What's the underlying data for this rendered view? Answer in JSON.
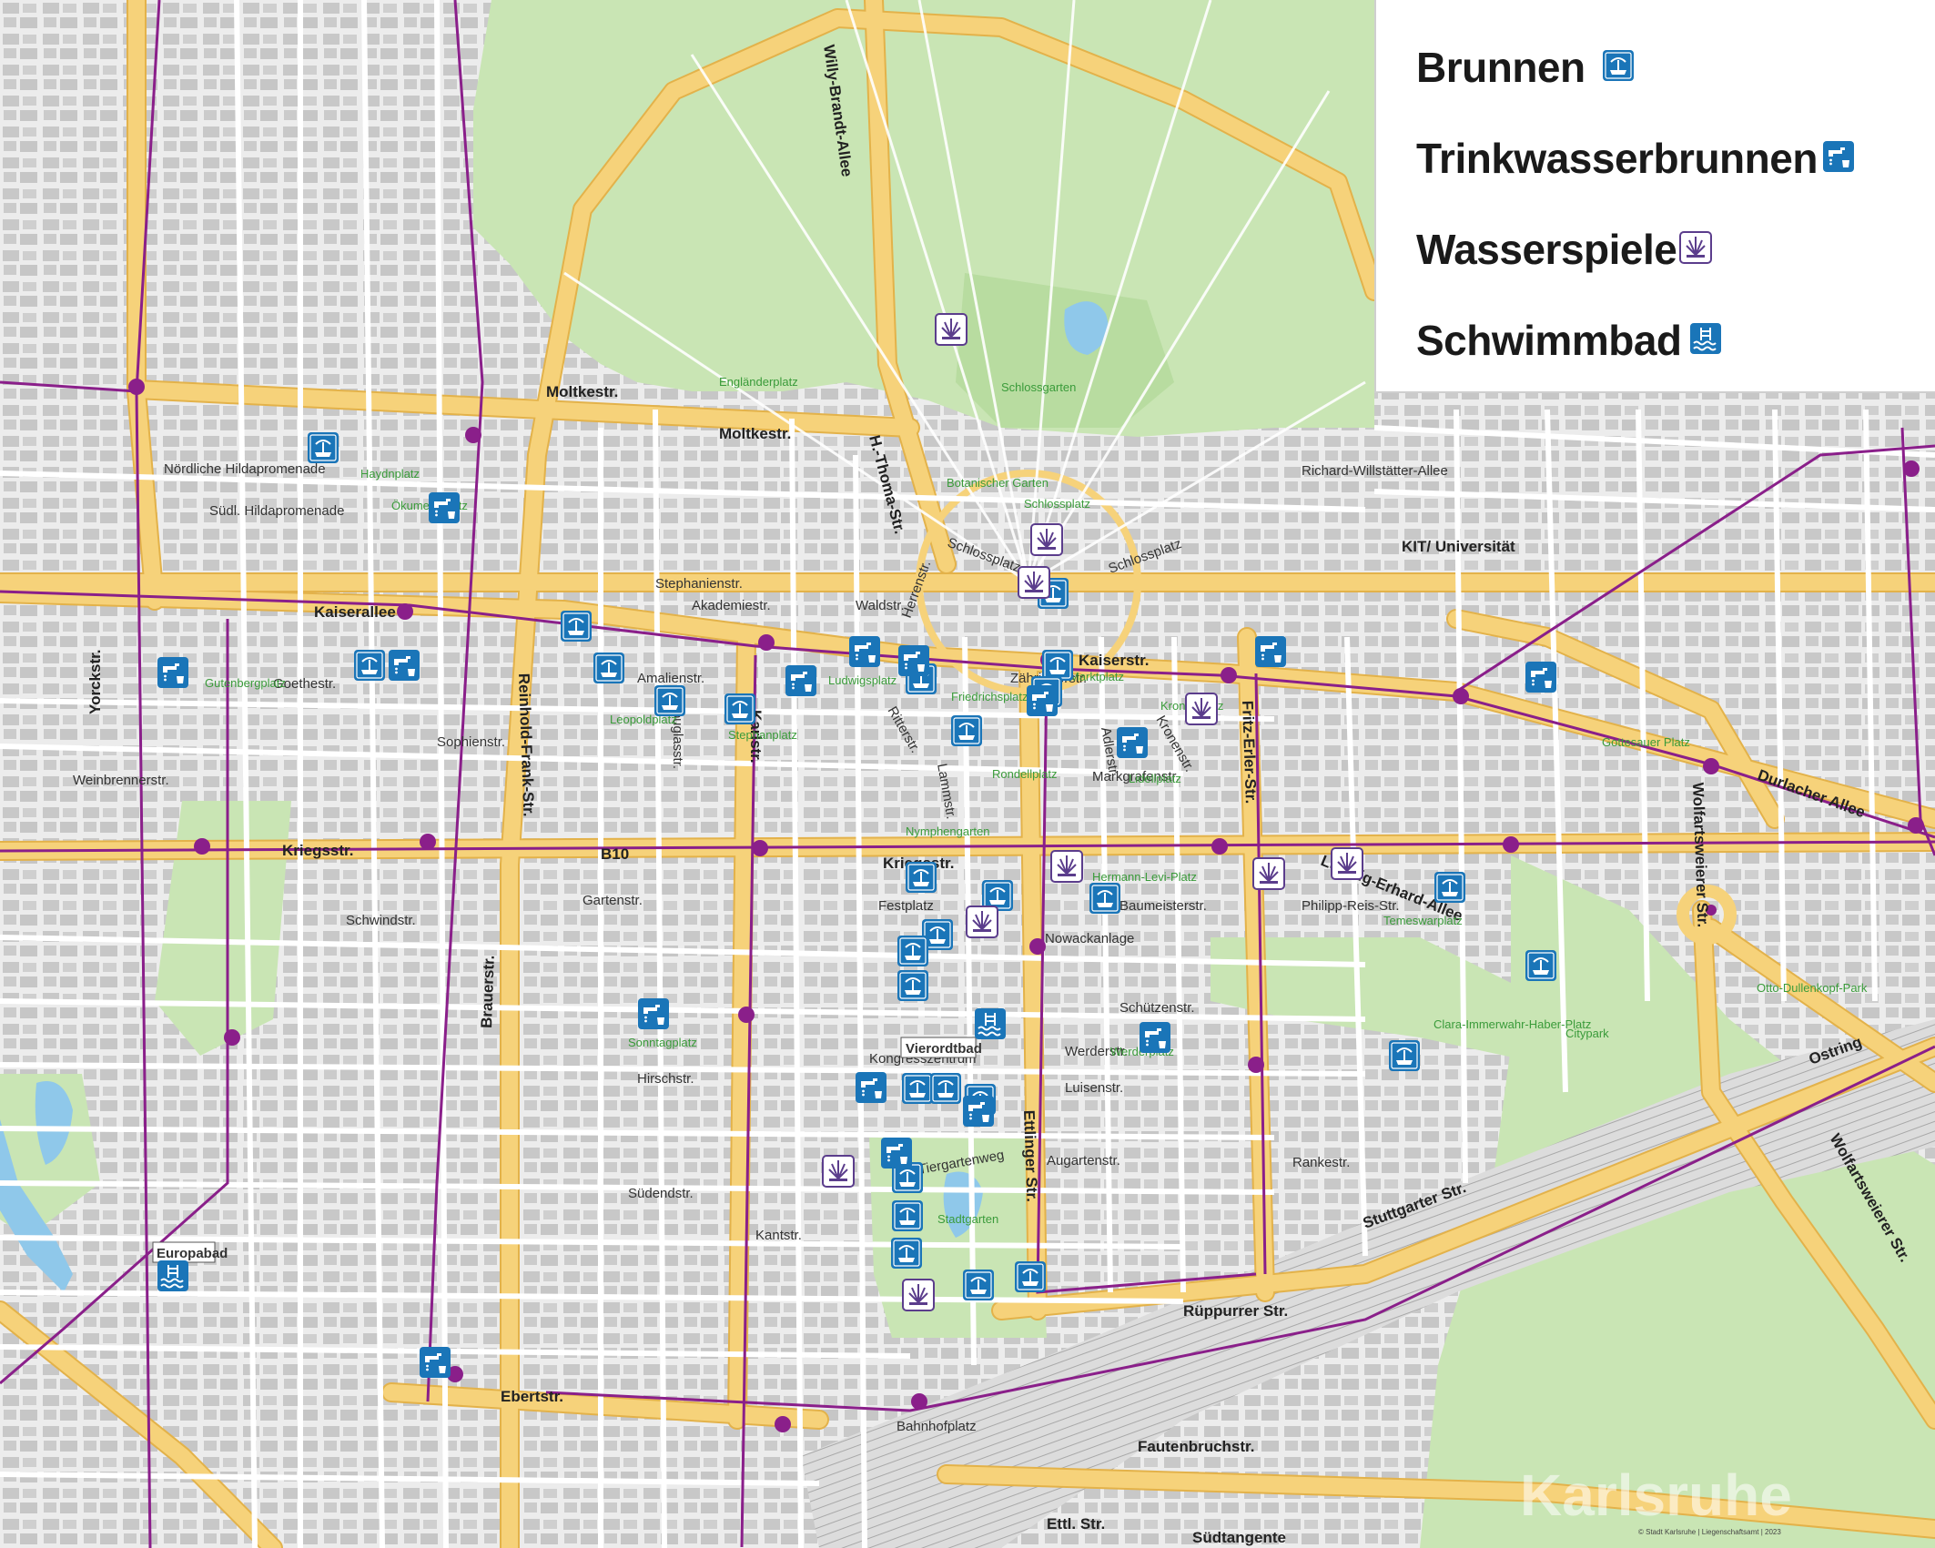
{
  "legend": {
    "items": [
      {
        "label": "Brunnen",
        "icon": "fountain-icon"
      },
      {
        "label": "Trinkwasserbrunnen",
        "icon": "drinking-fountain-icon"
      },
      {
        "label": "Wasserspiele",
        "icon": "water-play-icon"
      },
      {
        "label": "Schwimmbad",
        "icon": "swimming-pool-icon"
      }
    ]
  },
  "colors": {
    "major_road": "#f6d27a",
    "major_road_edge": "#e3b24a",
    "park": "#c9e5b4",
    "tram_line": "#8a1f8a",
    "poi_blue": "#1a75b8",
    "water_play_border": "#5b3d8c",
    "rail": "#c7c7c7",
    "building": "#c4c4c4"
  },
  "map": {
    "streets": [
      "Moltkestr.",
      "Kaiserallee",
      "Kaiserstr.",
      "Kriegsstr.",
      "B10",
      "Ebertstr.",
      "Rüppurrer Str.",
      "Stuttgarter Str.",
      "Durlacher Allee",
      "Willy-Brandt-Allee",
      "H.-Thoma-Str.",
      "Reinhold-Frank-Str.",
      "Brauerstr.",
      "Ettlinger Str.",
      "Karlstr.",
      "Fritz-Erler-Str.",
      "Ludwig-Erhard-Allee",
      "Wolfartsweierer Str.",
      "Schlossplatz",
      "Südtangente",
      "Fautenbruchstr.",
      "Ostring",
      "Zähringerstr.",
      "Amalienstr.",
      "Stephanienstr.",
      "Sophienstr.",
      "Akademiestr.",
      "Hirschstr.",
      "Douglasstr.",
      "Ritterstr.",
      "Lammstr.",
      "Herrenstr.",
      "Waldstr.",
      "Adlerstr.",
      "Kronenstr.",
      "Markgrafenstr.",
      "Gartenstr.",
      "Schwindstr.",
      "Nördliche Hildapromenade",
      "Südl. Hildapromenade",
      "Richard-Willstätter-Allee",
      "Kriegsstr.",
      "Baumeisterstr.",
      "Schützenstr.",
      "Werderstr.",
      "Luisenstr.",
      "Augartenstr.",
      "Rankestr.",
      "Südendstr.",
      "Kantstr.",
      "Tiergartenweg",
      "Bahnhofplatz",
      "Gottesauer Platz",
      "Ettl. Str.",
      "Yorckstr.",
      "Goethestr.",
      "Weinbrennerstr.",
      "Kaiserallee"
    ],
    "places": [
      "Schlossgarten",
      "Schlossplatz",
      "Botanischer Garten",
      "Stadtgarten",
      "Citypark",
      "Otto-Dullenkopf-Park",
      "Gutenbergplatz",
      "Haydnplatz",
      "Ökumeneplatz",
      "Ludwigsplatz",
      "Stephanplatz",
      "Leopoldplatz",
      "Friedrichsplatz",
      "Marktplatz",
      "Kronenplatz",
      "Lidellplatz",
      "Rondellplatz",
      "Nymphengarten",
      "Hermann-Levi-Platz",
      "Sonntagplatz",
      "Werderplatz",
      "Temeswarplatz",
      "Clara-Immerwahr-Haber-Platz",
      "Engländerplatz",
      "Kongresszentrum",
      "Nowackanlage",
      "Festplatz",
      "Philipp-Reis-Str.",
      "KIT/ Universität"
    ],
    "labels": {
      "vierordtbad": "Vierordtbad",
      "europabad": "Europabad",
      "karlsruhe": "Karlsruhe",
      "copyright": "© Stadt Karlsruhe | Liegenschaftsamt | 2023"
    }
  },
  "pois": [
    {
      "type": "fountain"
    },
    {
      "type": "fountain"
    },
    {
      "type": "fountain"
    },
    {
      "type": "fountain"
    },
    {
      "type": "fountain"
    },
    {
      "type": "fountain"
    },
    {
      "type": "fountain"
    },
    {
      "type": "fountain"
    },
    {
      "type": "fountain"
    },
    {
      "type": "fountain"
    },
    {
      "type": "fountain"
    },
    {
      "type": "fountain"
    },
    {
      "type": "fountain"
    },
    {
      "type": "fountain"
    },
    {
      "type": "fountain"
    },
    {
      "type": "fountain"
    },
    {
      "type": "fountain"
    },
    {
      "type": "fountain"
    },
    {
      "type": "fountain"
    },
    {
      "type": "fountain"
    },
    {
      "type": "fountain"
    },
    {
      "type": "fountain"
    },
    {
      "type": "fountain"
    },
    {
      "type": "fountain"
    },
    {
      "type": "fountain"
    },
    {
      "type": "fountain"
    },
    {
      "type": "fountain"
    },
    {
      "type": "fountain"
    },
    {
      "type": "drinking"
    },
    {
      "type": "drinking"
    },
    {
      "type": "drinking"
    },
    {
      "type": "drinking"
    },
    {
      "type": "drinking"
    },
    {
      "type": "drinking"
    },
    {
      "type": "drinking"
    },
    {
      "type": "drinking"
    },
    {
      "type": "drinking"
    },
    {
      "type": "drinking"
    },
    {
      "type": "drinking"
    },
    {
      "type": "drinking"
    },
    {
      "type": "drinking"
    },
    {
      "type": "drinking"
    },
    {
      "type": "drinking"
    },
    {
      "type": "drinking"
    },
    {
      "type": "water_play"
    },
    {
      "type": "water_play"
    },
    {
      "type": "water_play"
    },
    {
      "type": "water_play"
    },
    {
      "type": "water_play"
    },
    {
      "type": "water_play"
    },
    {
      "type": "water_play"
    },
    {
      "type": "water_play"
    },
    {
      "type": "water_play"
    },
    {
      "type": "water_play"
    },
    {
      "type": "pool"
    },
    {
      "type": "pool"
    }
  ]
}
